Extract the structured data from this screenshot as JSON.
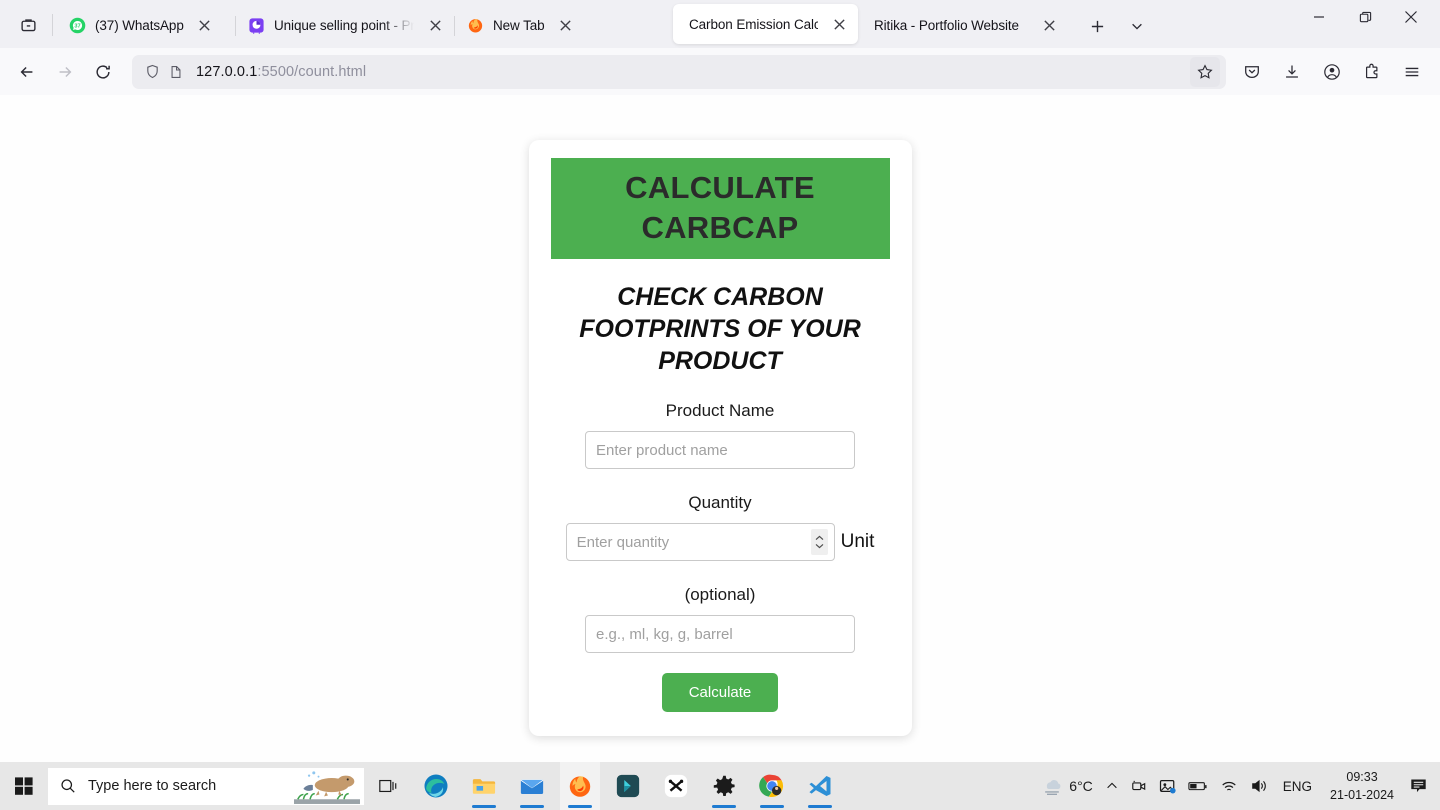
{
  "browser": {
    "firefox_view_label": "Firefox View",
    "tabs": [
      {
        "title": "(37) WhatsApp",
        "favicon": "whatsapp-icon",
        "badge": "37",
        "active": false,
        "truncated": false
      },
      {
        "title": "Unique selling point - Pre",
        "favicon": "presentation-icon",
        "active": false,
        "truncated": true
      },
      {
        "title": "New Tab",
        "favicon": "firefox-icon",
        "active": false,
        "truncated": false
      },
      {
        "title": "Carbon Emission Calculator",
        "favicon": "none",
        "active": true,
        "truncated": false
      },
      {
        "title": "Ritika - Portfolio Website",
        "favicon": "none",
        "active": false,
        "truncated": false
      }
    ],
    "new_tab_label": "+",
    "list_all_tabs_label": "v",
    "window_controls": {
      "minimize": "minimize-button",
      "maximize": "maximize-button",
      "close": "close-button"
    },
    "nav": {
      "back": "back-button",
      "forward": "forward-button",
      "reload": "reload-button"
    },
    "url": {
      "host": "127.0.0.1",
      "path": ":5500/count.html",
      "full": "127.0.0.1:5500/count.html",
      "shield_icon": "shield-icon",
      "page_icon": "page-icon",
      "bookmark_icon": "star-icon"
    },
    "toolbar_icons": [
      "pocket-save-icon",
      "downloads-icon",
      "account-icon",
      "extensions-icon",
      "app-menu-icon"
    ]
  },
  "page": {
    "banner_title": "CALCULATE CARBCAP",
    "subtitle": "CHECK CARBON FOOTPRINTS OF YOUR PRODUCT",
    "product": {
      "label": "Product Name",
      "placeholder": "Enter product name",
      "value": ""
    },
    "quantity": {
      "label": "Quantity",
      "placeholder": "Enter quantity",
      "value": "",
      "unit_side_label": "Unit"
    },
    "unit": {
      "label": "(optional)",
      "placeholder": "e.g., ml, kg, g, barrel",
      "value": ""
    },
    "submit_label": "Calculate",
    "colors": {
      "banner_green": "#4caf50",
      "button_green": "#4caf50",
      "banner_text": "#2b2b2b",
      "card_background": "#ffffff"
    }
  },
  "taskbar": {
    "start_label": "start-button",
    "search_placeholder": "Type here to search",
    "task_view_label": "task-view-button",
    "apps": [
      {
        "name": "microsoft-edge",
        "running": false
      },
      {
        "name": "file-explorer",
        "running": true
      },
      {
        "name": "mail",
        "running": true
      },
      {
        "name": "firefox",
        "running": true,
        "active": true
      },
      {
        "name": "filmora",
        "running": false
      },
      {
        "name": "capcut",
        "running": false
      },
      {
        "name": "settings",
        "running": true
      },
      {
        "name": "google-chrome",
        "running": true
      },
      {
        "name": "visual-studio-code",
        "running": true
      }
    ],
    "tray": {
      "weather_temp": "6°C",
      "weather_icon": "cloud-fog-icon",
      "show_hidden_icons": "chevron-up-icon",
      "icons": [
        "meet-camera-icon",
        "photos-icon",
        "battery-icon",
        "wifi-icon",
        "volume-icon"
      ],
      "language": "ENG",
      "time": "09:33",
      "date": "21-01-2024",
      "notifications": "notification-icon"
    }
  }
}
